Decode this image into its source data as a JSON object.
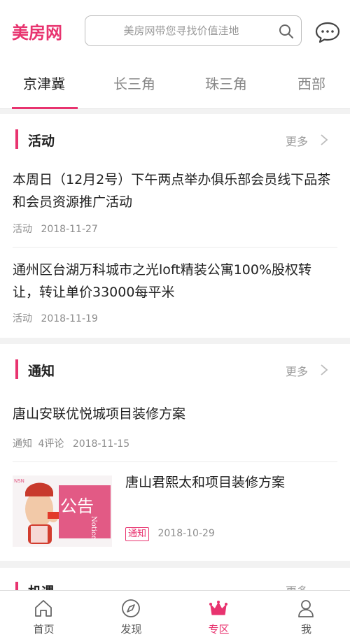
{
  "app": {
    "logo": "美房网"
  },
  "search": {
    "placeholder": "美房网带您寻找价值洼地"
  },
  "tabs": [
    {
      "label": "京津冀",
      "active": true
    },
    {
      "label": "长三角",
      "active": false
    },
    {
      "label": "珠三角",
      "active": false
    },
    {
      "label": "西部",
      "active": false
    }
  ],
  "sections": {
    "activity": {
      "title": "活动",
      "more": "更多",
      "items": [
        {
          "title": "本周日（12月2号）下午两点举办俱乐部会员线下品茶和会员资源推广活动",
          "category": "活动",
          "date": "2018-11-27"
        },
        {
          "title": "通州区台湖万科城市之光loft精装公寓100%股权转让，转让单价33000每平米",
          "category": "活动",
          "date": "2018-11-19"
        }
      ]
    },
    "notice": {
      "title": "通知",
      "more": "更多",
      "items": [
        {
          "title": "唐山安联优悦城项目装修方案",
          "category": "通知",
          "comments": "4评论",
          "date": "2018-11-15"
        },
        {
          "title": "唐山君熙太和项目装修方案",
          "tag": "通知",
          "date": "2018-10-29",
          "thumb_text": "公告",
          "thumb_sub": "Notice",
          "thumb_corner": "NSN"
        }
      ]
    },
    "partial": {
      "title": "机遇",
      "more": "更多"
    }
  },
  "bottom_nav": [
    {
      "label": "首页",
      "icon": "home-icon",
      "active": false
    },
    {
      "label": "发现",
      "icon": "compass-icon",
      "active": false
    },
    {
      "label": "专区",
      "icon": "crown-icon",
      "active": true
    },
    {
      "label": "我",
      "icon": "person-icon",
      "active": false
    }
  ],
  "colors": {
    "accent": "#e8336f",
    "muted": "#8d8d8d",
    "background": "#f2f2f2"
  }
}
